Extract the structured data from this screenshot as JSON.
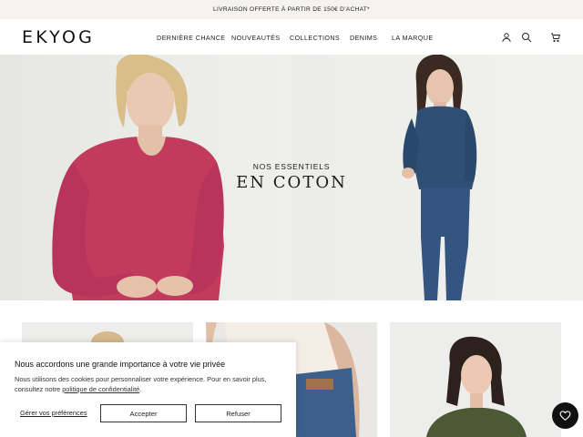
{
  "promo": {
    "text": "LIVRAISON OFFERTE À PARTIR DE 150€ D'ACHAT*"
  },
  "header": {
    "logo": "EKYOG",
    "nav": [
      "DERNIÈRE CHANCE",
      "NOUVEAUTÉS",
      "COLLECTIONS",
      "DENIMS",
      "LA MARQUE"
    ],
    "icons": [
      "account-icon",
      "search-icon",
      "cart-icon"
    ]
  },
  "hero": {
    "subtitle": "NOS ESSENTIELS",
    "title": "EN COTON"
  },
  "cookie": {
    "title": "Nous accordons une grande importance à votre vie privée",
    "text_before": "Nous utilisons des cookies pour personnaliser votre expérience. Pour en savoir plus, consultez notre ",
    "policy_link": "politique de confidentialité",
    "text_after": ".",
    "manage_label": "Gérer vos préférences",
    "accept_label": "Accepter",
    "refuse_label": "Refuser"
  },
  "colors": {
    "promo_bg": "#f6f2ee",
    "hero_bg": "#ececea",
    "sweater_pink": "#c23a5c",
    "denim_blue": "#2f4f77",
    "fab_bg": "#111111"
  }
}
